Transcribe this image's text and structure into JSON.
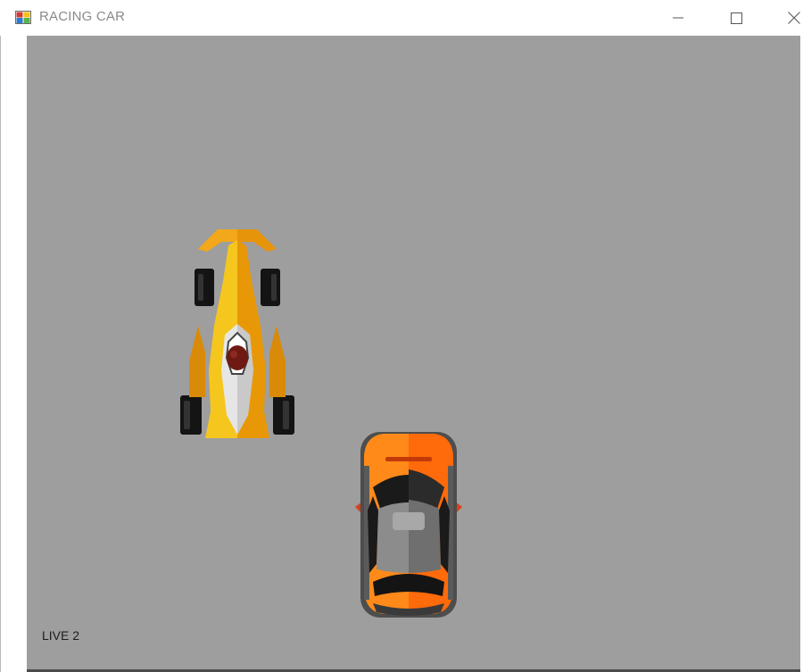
{
  "window": {
    "title": "RACING CAR",
    "controls": {
      "minimize_icon": "minimize-icon",
      "maximize_icon": "maximize-icon",
      "close_icon": "close-icon"
    }
  },
  "game": {
    "background_color": "#9e9e9e",
    "lives_label": "LIVE 2",
    "cars": [
      {
        "name": "yellow-formula-car",
        "color": "#f0b400"
      },
      {
        "name": "orange-player-car",
        "color": "#ff7a1a"
      }
    ]
  }
}
